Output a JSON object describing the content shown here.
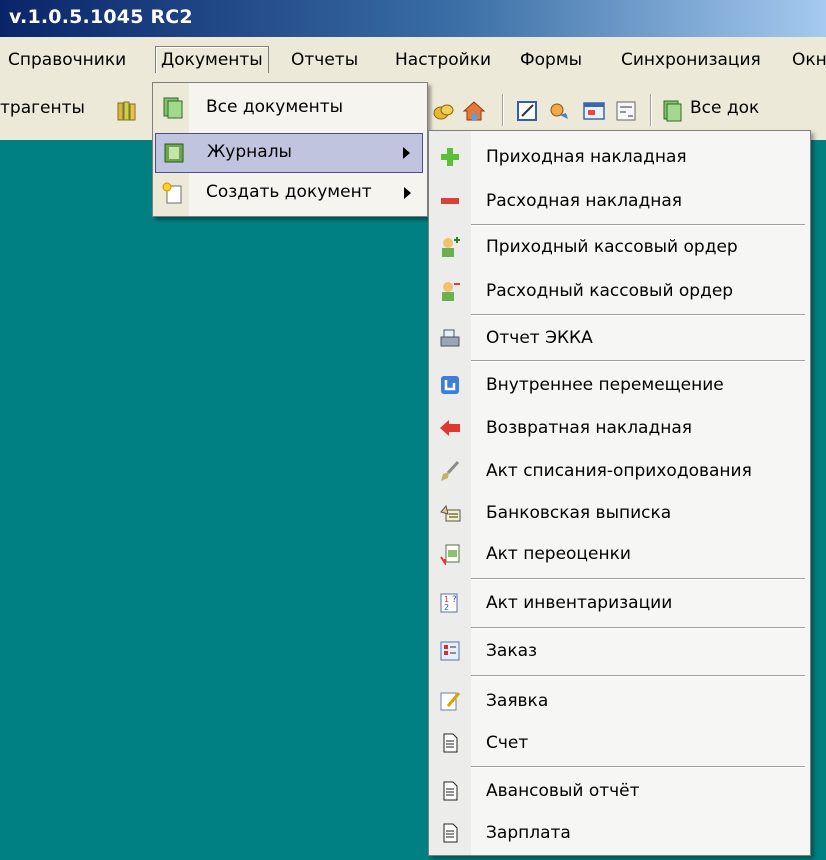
{
  "window": {
    "title": "v.1.0.5.1045 RC2"
  },
  "menubar": {
    "items": [
      "Справочники",
      "Документы",
      "Отчеты",
      "Настройки",
      "Формы",
      "Синхронизация",
      "Окн"
    ]
  },
  "toolbar": {
    "left_label": "трагенты",
    "right_label": "Все док"
  },
  "documents_menu": {
    "items": [
      {
        "label": "Все документы",
        "icon": "documents-stack-icon"
      },
      {
        "label": "Журналы",
        "icon": "journal-book-icon",
        "has_submenu": true,
        "selected": true
      },
      {
        "label": "Создать документ",
        "icon": "new-document-icon",
        "has_submenu": true
      }
    ]
  },
  "journals_menu": {
    "items": [
      {
        "label": "Приходная накладная",
        "icon": "plus-green-icon"
      },
      {
        "label": "Расходная накладная",
        "icon": "minus-red-icon"
      },
      {
        "label": "Приходный кассовый ордер",
        "icon": "user-plus-icon"
      },
      {
        "label": "Расходный кассовый ордер",
        "icon": "user-minus-icon"
      },
      {
        "label": "Отчет ЭККА",
        "icon": "cash-register-icon"
      },
      {
        "label": "Внутреннее перемещение",
        "icon": "internal-move-icon"
      },
      {
        "label": "Возвратная накладная",
        "icon": "return-arrow-icon"
      },
      {
        "label": "Акт списания-оприходования",
        "icon": "brush-icon"
      },
      {
        "label": "Банковская выписка",
        "icon": "bank-statement-icon"
      },
      {
        "label": "Акт переоценки",
        "icon": "revaluation-icon"
      },
      {
        "label": "Акт инвентаризации",
        "icon": "inventory-icon"
      },
      {
        "label": "Заказ",
        "icon": "order-form-icon"
      },
      {
        "label": "Заявка",
        "icon": "request-pencil-icon"
      },
      {
        "label": "Счет",
        "icon": "document-page-icon"
      },
      {
        "label": "Авансовый отчёт",
        "icon": "document-page-icon"
      },
      {
        "label": "Зарплата",
        "icon": "document-page-icon"
      }
    ]
  }
}
